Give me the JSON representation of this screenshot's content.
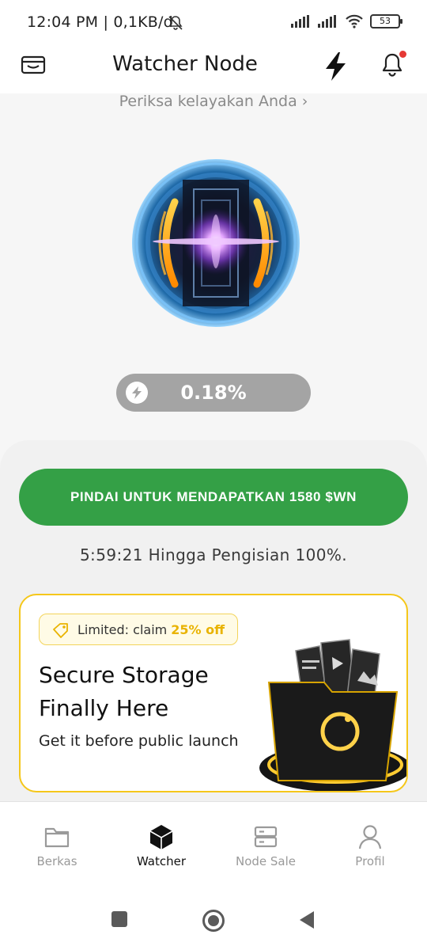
{
  "status_bar": {
    "time_text": "12:04 PM | 0,1KB/d",
    "battery_level": "53"
  },
  "header": {
    "title": "Watcher Node",
    "icons": [
      "wallet-icon",
      "lightning-icon",
      "bell-icon"
    ],
    "has_notification": true
  },
  "eligibility_link": "Periksa kelayakan Anda ›",
  "progress": {
    "value_text": "0.18%",
    "icon": "lightning-icon"
  },
  "scan_button_label": "PINDAI UNTUK MENDAPATKAN 1580 $WN",
  "countdown_text": "5:59:21 Hingga Pengisian 100%.",
  "promo": {
    "tag_prefix": "Limited: claim",
    "tag_highlight": "25% off",
    "title": "Secure Storage Finally Here",
    "subtitle": "Get it before public launch"
  },
  "nav": {
    "items": [
      {
        "label": "Berkas",
        "icon": "folder-icon",
        "active": false
      },
      {
        "label": "Watcher",
        "icon": "cube-icon",
        "active": true
      },
      {
        "label": "Node Sale",
        "icon": "server-icon",
        "active": false
      },
      {
        "label": "Profil",
        "icon": "user-icon",
        "active": false
      }
    ]
  },
  "system_nav": [
    "recents-button",
    "home-button",
    "back-button"
  ],
  "colors": {
    "accent_green": "#34a046",
    "promo_border": "#f5c71a",
    "highlight_yellow": "#e9b300",
    "notification_red": "#e53935",
    "pill_gray": "#a4a4a4"
  }
}
